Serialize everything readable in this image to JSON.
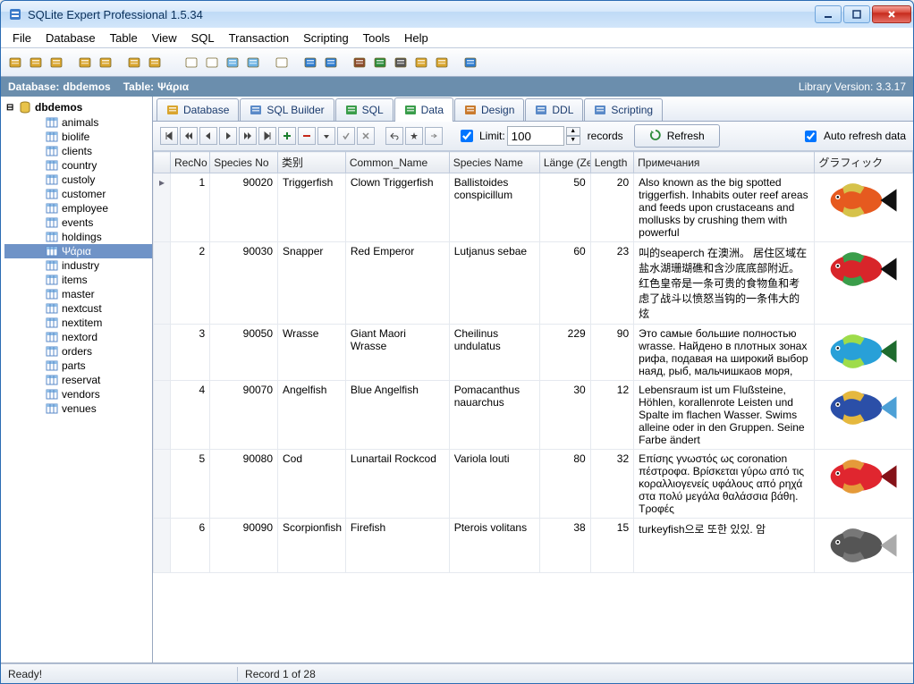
{
  "window": {
    "title": "SQLite Expert Professional 1.5.34"
  },
  "menubar": [
    "File",
    "Database",
    "Table",
    "View",
    "SQL",
    "Transaction",
    "Scripting",
    "Tools",
    "Help"
  ],
  "infobar": {
    "db_label": "Database:",
    "db": "dbdemos",
    "table_label": "Table:",
    "table": "Ψάρια",
    "lib": "Library Version: 3.3.17"
  },
  "sidebar": {
    "db": "dbdemos",
    "tables": [
      "animals",
      "biolife",
      "clients",
      "country",
      "custoly",
      "customer",
      "employee",
      "events",
      "holdings",
      "Ψάρια",
      "industry",
      "items",
      "master",
      "nextcust",
      "nextitem",
      "nextord",
      "orders",
      "parts",
      "reservat",
      "vendors",
      "venues"
    ],
    "selected": "Ψάρια"
  },
  "tabs": [
    {
      "label": "Database"
    },
    {
      "label": "SQL Builder"
    },
    {
      "label": "SQL"
    },
    {
      "label": "Data"
    },
    {
      "label": "Design"
    },
    {
      "label": "DDL"
    },
    {
      "label": "Scripting"
    }
  ],
  "tabs_active": 3,
  "data_toolbar": {
    "limit_checked": true,
    "limit_label": "Limit:",
    "limit_value": "100",
    "records_label": "records",
    "refresh_label": "Refresh",
    "auto_refresh_checked": true,
    "auto_refresh_label": "Auto refresh data"
  },
  "grid": {
    "columns": [
      "",
      "RecNo",
      "Species No",
      "类别",
      "Common_Name",
      "Species Name",
      "Länge (Zentimeter)",
      "Length",
      "Примечания",
      "グラフィック"
    ],
    "rows": [
      {
        "marker": "▸",
        "RecNo": 1,
        "SpeciesNo": 90020,
        "Category": "Triggerfish",
        "CommonName": "Clown Triggerfish",
        "SpeciesName": "Ballistoides conspicillum",
        "LangeCm": 50,
        "Length": 20,
        "Notes": "Also known as the big spotted triggerfish.  Inhabits outer reef areas and feeds upon crustaceans and mollusks by crushing them with powerful",
        "fish_colors": [
          "#e65a1f",
          "#111",
          "#d6c24a"
        ]
      },
      {
        "marker": "",
        "RecNo": 2,
        "SpeciesNo": 90030,
        "Category": "Snapper",
        "CommonName": "Red Emperor",
        "SpeciesName": "Lutjanus sebae",
        "LangeCm": 60,
        "Length": 23,
        "Notes": "叫的seaperch 在澳洲。 居住区域在盐水湖珊瑚礁和含沙底底部附近。 红色皇帝是一条可贵的食物鱼和考虑了战斗以愤怒当钩的一条伟大的炫",
        "fish_colors": [
          "#d8252a",
          "#111",
          "#3a9d4a"
        ]
      },
      {
        "marker": "",
        "RecNo": 3,
        "SpeciesNo": 90050,
        "Category": "Wrasse",
        "CommonName": "Giant Maori Wrasse",
        "SpeciesName": "Cheilinus undulatus",
        "LangeCm": 229,
        "Length": 90,
        "Notes": "Это самые большие полностью wrasse. Найдено в плотных зонах рифа, подавая на широкий выбор наяд, рыб, мальчишкаов моря,",
        "fish_colors": [
          "#28a0d8",
          "#1e6b2e",
          "#9edc4a"
        ]
      },
      {
        "marker": "",
        "RecNo": 4,
        "SpeciesNo": 90070,
        "Category": "Angelfish",
        "CommonName": "Blue Angelfish",
        "SpeciesName": "Pomacanthus nauarchus",
        "LangeCm": 30,
        "Length": 12,
        "Notes": "Lebensraum ist um Flußsteine, Höhlen, korallenrote Leisten und Spalte im flachen Wasser. Swims alleine oder in den Gruppen. Seine Farbe ändert",
        "fish_colors": [
          "#2b4fa8",
          "#4da0d6",
          "#e5b83e"
        ]
      },
      {
        "marker": "",
        "RecNo": 5,
        "SpeciesNo": 90080,
        "Category": "Cod",
        "CommonName": "Lunartail Rockcod",
        "SpeciesName": "Variola louti",
        "LangeCm": 80,
        "Length": 32,
        "Notes": "Επίσης γνωστός ως coronation πέστροφα. Βρίσκεται γύρω από τις κοραλλιογενείς υφάλους από ρηχά στα πολύ μεγάλα θαλάσσια βάθη. Τροφές",
        "fish_colors": [
          "#e0262f",
          "#851218",
          "#e59a3a"
        ]
      },
      {
        "marker": "",
        "RecNo": 6,
        "SpeciesNo": 90090,
        "Category": "Scorpionfish",
        "CommonName": "Firefish",
        "SpeciesName": "Pterois volitans",
        "LangeCm": 38,
        "Length": 15,
        "Notes": "turkeyfish으로 또한 있있. 암",
        "fish_colors": [
          "#555",
          "#aaa",
          "#777"
        ]
      }
    ]
  },
  "status": {
    "ready": "Ready!",
    "record": "Record 1 of 28"
  }
}
